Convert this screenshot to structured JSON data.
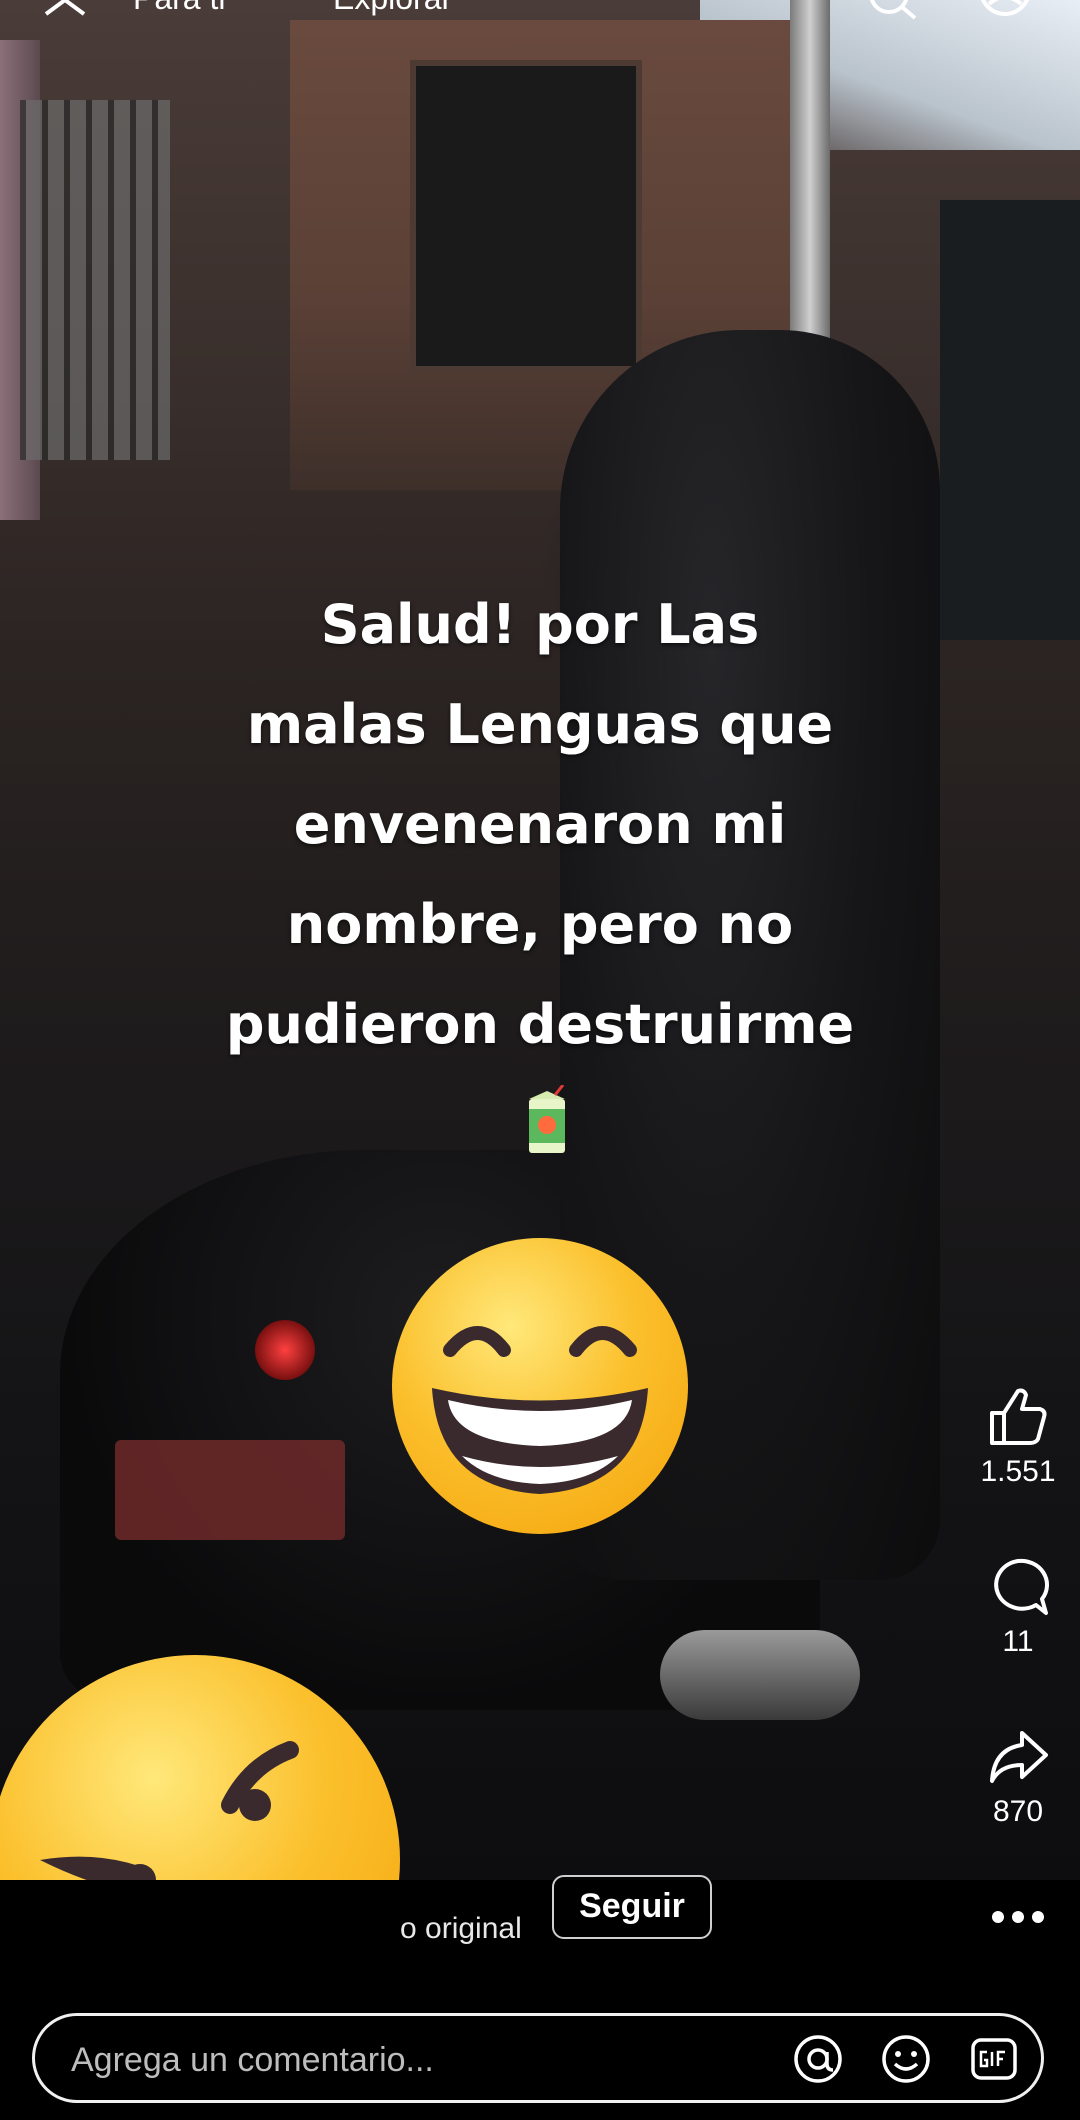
{
  "top_bar": {
    "tabs": [
      "Para ti",
      "Explorar"
    ]
  },
  "video": {
    "caption": "Salud! por Las\nmalas Lenguas que\nenvenenaron mi\nnombre, pero no\npudieron destruirme"
  },
  "actions": {
    "likes": "1.551",
    "comments": "11",
    "shares": "870"
  },
  "audio": {
    "label": "o original"
  },
  "follow": {
    "label": "Seguir"
  },
  "comment_bar": {
    "placeholder": "Agrega un comentario..."
  },
  "icons": [
    "close-icon",
    "search-icon",
    "profile-icon",
    "like-icon",
    "comment-icon",
    "share-icon",
    "more-icon",
    "mention-icon",
    "emoji-icon",
    "gif-icon",
    "juice-box-emoji"
  ],
  "colors": {
    "emoji_yellow": "#fbc02d",
    "emoji_dark": "#3a2a2e",
    "background": "#000000"
  }
}
